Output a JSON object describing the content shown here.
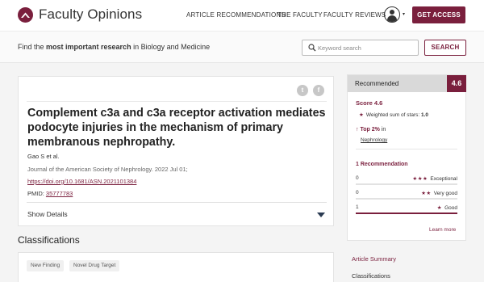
{
  "header": {
    "brand": "Faculty Opinions",
    "nav": [
      "ARTICLE RECOMMENDATIONS",
      "THE FACULTY",
      "FACULTY REVIEWS"
    ],
    "cta_label": "GET ACCESS",
    "user_caret": "▾"
  },
  "search": {
    "tagline_pre": "Find the ",
    "tagline_bold": "most important research",
    "tagline_post": " in Biology and Medicine",
    "placeholder": "Keyword search",
    "button_label": "SEARCH"
  },
  "article": {
    "share_twitter": "t",
    "share_facebook": "f",
    "title": "Complement c3a and c3a receptor activation mediates podocyte injuries in the mechanism of primary membranous nephropathy.",
    "authors": "Gao S et al.",
    "journal": "Journal of the American Society of Nephrology. 2022 Jul 01;",
    "doi": "https://doi.org/10.1681/ASN.2021101384",
    "pmid_label": "PMID: ",
    "pmid_value": "35777783",
    "show_details": "Show Details"
  },
  "classifications": {
    "heading": "Classifications",
    "chips": [
      "New Finding",
      "Novel Drug Target"
    ]
  },
  "recommended": {
    "header_label": "Recommended",
    "score_box": "4.6",
    "score_text": "Score 4.6",
    "weighted_label": "Weighted sum of stars: ",
    "weighted_value": "1.0",
    "top_arrow": "↑",
    "top_pct": "Top 2%",
    "top_in": " in",
    "field": "Nephrology",
    "count_label": "1 Recommendation",
    "rows": [
      {
        "count": "0",
        "stars": "★★★",
        "label": "Exceptional",
        "fraction": 0
      },
      {
        "count": "0",
        "stars": "★★",
        "label": "Very good",
        "fraction": 0
      },
      {
        "count": "1",
        "stars": "★",
        "label": "Good",
        "fraction": 1
      }
    ],
    "learn_more": "Learn more",
    "star": "★"
  },
  "sidebar_links": [
    "Article Summary",
    "Classifications"
  ],
  "colors": {
    "brand": "#7a1f3d",
    "header_gray": "#d9d9d9"
  }
}
